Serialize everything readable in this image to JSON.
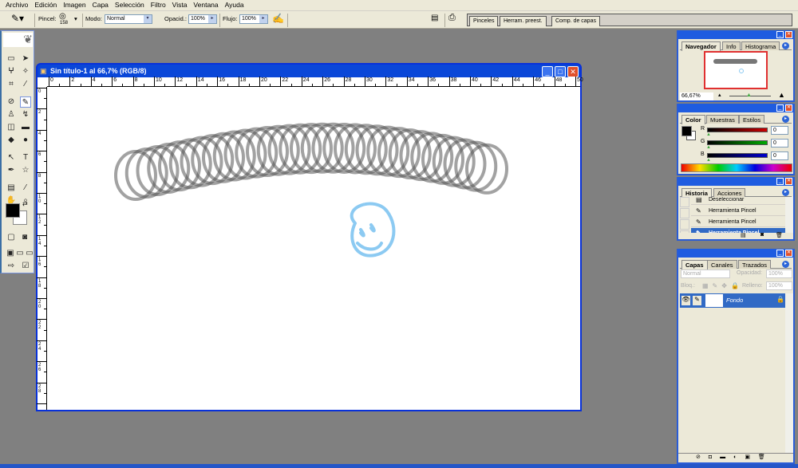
{
  "menu": [
    "Archivo",
    "Edición",
    "Imagen",
    "Capa",
    "Selección",
    "Filtro",
    "Vista",
    "Ventana",
    "Ayuda"
  ],
  "options": {
    "brush_label": "Pincel:",
    "brush_size": "158",
    "mode_label": "Modo:",
    "mode_value": "Normal",
    "opacity_label": "Opacid.:",
    "opacity_value": "100%",
    "flow_label": "Flujo:",
    "flow_value": "100%"
  },
  "well_tabs": [
    "Pinceles",
    "Herram. preest.",
    "Comp. de capas"
  ],
  "document": {
    "title": "Sin título-1 al 66,7% (RGB/8)",
    "h_ruler": [
      "0",
      "2",
      "4",
      "6",
      "8",
      "10",
      "12",
      "14",
      "16",
      "18",
      "20",
      "22",
      "24",
      "26",
      "28",
      "30",
      "32",
      "34",
      "36",
      "38",
      "40",
      "42",
      "44",
      "46",
      "48",
      "50"
    ],
    "v_ruler": [
      "0",
      "2",
      "4",
      "6",
      "8",
      "10",
      "12",
      "14",
      "16",
      "18",
      "20",
      "22",
      "24",
      "26",
      "28",
      "30"
    ]
  },
  "navigator": {
    "tabs": [
      "Navegador",
      "Info",
      "Histograma"
    ],
    "zoom": "66,67%"
  },
  "color": {
    "tabs": [
      "Color",
      "Muestras",
      "Estilos"
    ],
    "channels": [
      {
        "label": "R",
        "value": "0",
        "color": "#cc0000"
      },
      {
        "label": "G",
        "value": "0",
        "color": "#00aa00"
      },
      {
        "label": "B",
        "value": "0",
        "color": "#0000cc"
      }
    ]
  },
  "history": {
    "tabs": [
      "Historia",
      "Acciones"
    ],
    "items": [
      "Deseleccionar",
      "Herramienta Pincel",
      "Herramienta Pincel",
      "Herramienta Pincel"
    ],
    "selected": 3
  },
  "layers": {
    "tabs": [
      "Capas",
      "Canales",
      "Trazados"
    ],
    "blend": "Normal",
    "opacity_label": "Opacidad:",
    "opacity": "100%",
    "lock_label": "Bloq.:",
    "fill_label": "Relleno:",
    "fill": "100%",
    "layer_name": "Fondo"
  },
  "colors": {
    "accent": "#316ac5",
    "titlebar": "#0a47d8",
    "stroke_gray": "#555555",
    "stroke_blue": "#8ccaf2"
  }
}
